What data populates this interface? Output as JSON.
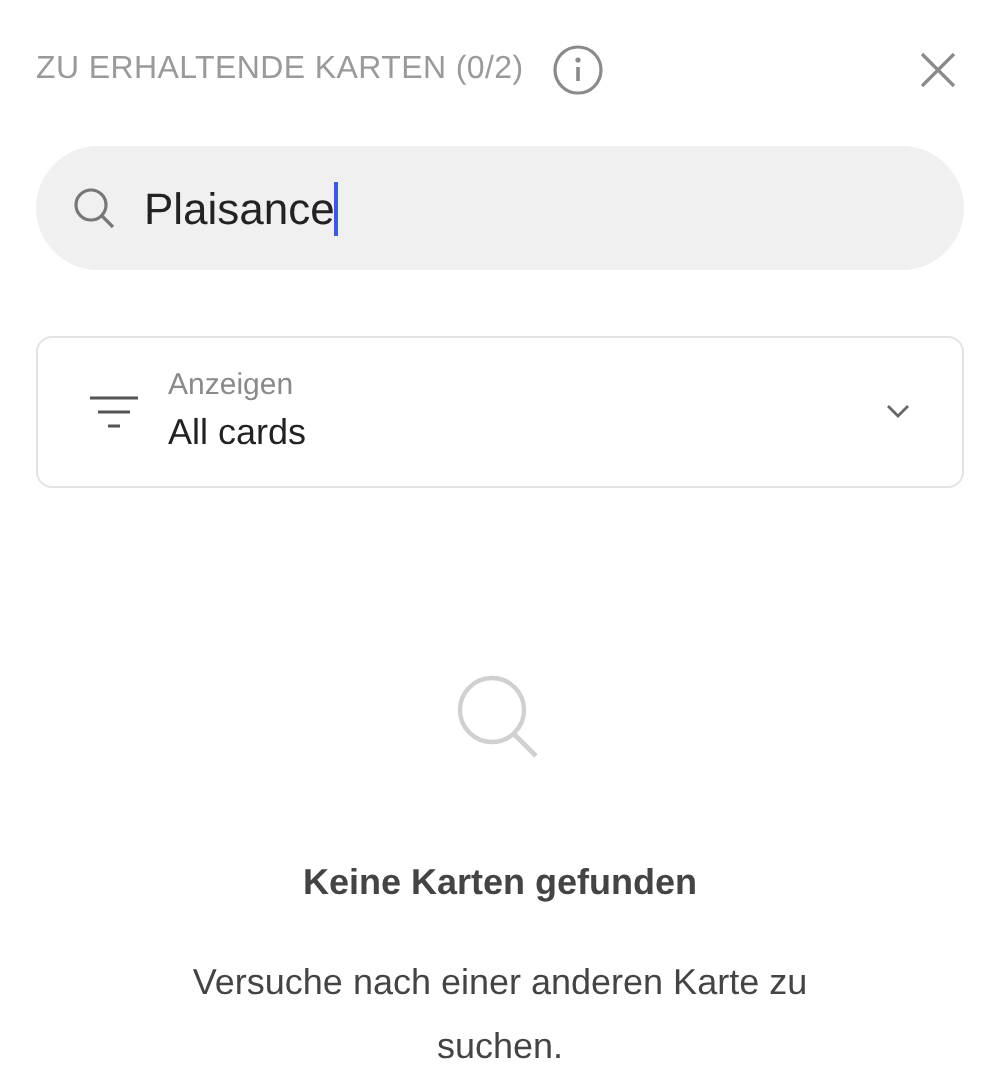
{
  "header": {
    "title": "ZU ERHALTENDE KARTEN (0/2)"
  },
  "search": {
    "value": "Plaisance",
    "focused": true
  },
  "filter": {
    "label": "Anzeigen",
    "value": "All cards"
  },
  "empty_state": {
    "title": "Keine Karten gefunden",
    "message": "Versuche nach einer anderen Karte zu suchen."
  }
}
